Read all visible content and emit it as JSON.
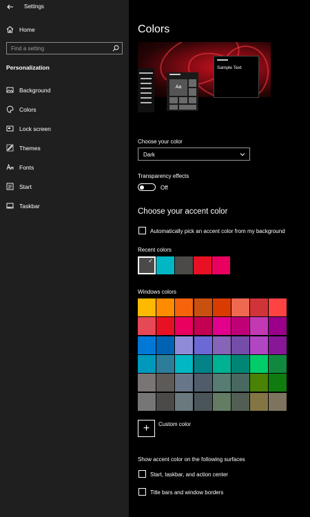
{
  "app_title": "Settings",
  "sidebar": {
    "home_label": "Home",
    "search_placeholder": "Find a setting",
    "section_title": "Personalization",
    "items": [
      {
        "label": "Background",
        "icon": "image-icon"
      },
      {
        "label": "Colors",
        "icon": "palette-icon"
      },
      {
        "label": "Lock screen",
        "icon": "lock-screen-icon"
      },
      {
        "label": "Themes",
        "icon": "themes-icon"
      },
      {
        "label": "Fonts",
        "icon": "fonts-icon"
      },
      {
        "label": "Start",
        "icon": "start-icon"
      },
      {
        "label": "Taskbar",
        "icon": "taskbar-icon"
      }
    ]
  },
  "main": {
    "title": "Colors",
    "preview": {
      "tile_label": "Aa",
      "sample_text": "Sample Text"
    },
    "choose_color_label": "Choose your color",
    "choose_color_value": "Dark",
    "transparency_label": "Transparency effects",
    "transparency_state": "Off",
    "accent_heading": "Choose your accent color",
    "auto_pick_label": "Automatically pick an accent color from my background",
    "recent_label": "Recent colors",
    "recent_colors": [
      "#4c4a48",
      "#00b7c3",
      "#4c4a48",
      "#e81123",
      "#ea005e"
    ],
    "windows_label": "Windows colors",
    "windows_colors": [
      [
        "#ffb900",
        "#ff8c00",
        "#f7630c",
        "#ca5010",
        "#da3b01",
        "#ef6950",
        "#d13438",
        "#ff4343"
      ],
      [
        "#e74856",
        "#e81123",
        "#ea005e",
        "#c30052",
        "#e3008c",
        "#bf0077",
        "#c239b3",
        "#9a0089"
      ],
      [
        "#0078d7",
        "#0063b1",
        "#8e8cd8",
        "#6b69d6",
        "#8764b8",
        "#744da9",
        "#b146c2",
        "#881798"
      ],
      [
        "#0099bc",
        "#2d7d9a",
        "#00b7c3",
        "#038387",
        "#00b294",
        "#018574",
        "#00cc6a",
        "#10893e"
      ],
      [
        "#7a7574",
        "#5d5a58",
        "#68768a",
        "#515c6b",
        "#567c73",
        "#486860",
        "#498205",
        "#107c10"
      ],
      [
        "#767676",
        "#4c4a48",
        "#69797e",
        "#4a5459",
        "#647c64",
        "#525e54",
        "#847545",
        "#7e735f"
      ]
    ],
    "custom_color_label": "Custom color",
    "surfaces_label": "Show accent color on the following surfaces",
    "surface_start_label": "Start, taskbar, and action center",
    "surface_titlebar_label": "Title bars and window borders"
  }
}
